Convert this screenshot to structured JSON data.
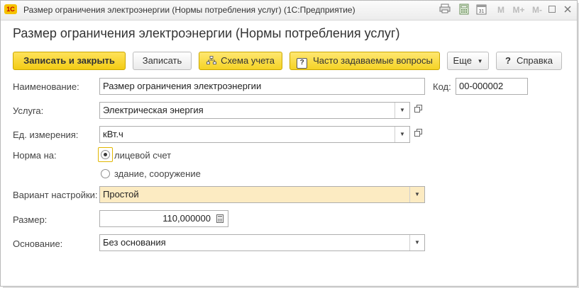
{
  "window": {
    "title": "Размер ограничения электроэнергии (Нормы потребления услуг)  (1С:Предприятие)",
    "logo_text": "1С",
    "title_buttons": [
      "M",
      "M+",
      "M-"
    ]
  },
  "form": {
    "title": "Размер ограничения электроэнергии (Нормы потребления услуг)"
  },
  "toolbar": {
    "save_close_label": "Записать и закрыть",
    "save_label": "Записать",
    "scheme_label": "Схема учета",
    "faq_label": "Часто задаваемые вопросы",
    "more_label": "Еще",
    "help_label": "Справка"
  },
  "fields": {
    "name_label": "Наименование:",
    "name_value": "Размер ограничения электроэнергии",
    "code_label": "Код:",
    "code_value": "00-000002",
    "service_label": "Услуга:",
    "service_value": "Электрическая энергия",
    "unit_label": "Ед. измерения:",
    "unit_value": "кВт.ч",
    "norm_label": "Норма на:",
    "norm_options": [
      "лицевой счет",
      "здание, сооружение"
    ],
    "norm_selected": "лицевой счет",
    "variant_label": "Вариант настройки:",
    "variant_value": "Простой",
    "size_label": "Размер:",
    "size_value": "110,000000",
    "basis_label": "Основание:",
    "basis_value": "Без основания"
  },
  "colors": {
    "primary_button": "#f3cc14",
    "highlight_field": "#fcebc2"
  },
  "icons": {
    "logo": "1c-logo-icon",
    "print": "print-icon",
    "calculator": "calculator-icon",
    "calendar": "calendar-icon",
    "restore": "restore-window-icon",
    "close": "close-icon",
    "scheme": "hierarchy-icon",
    "faq": "question-icon",
    "dropdown": "chevron-down-icon",
    "open": "open-form-icon"
  }
}
